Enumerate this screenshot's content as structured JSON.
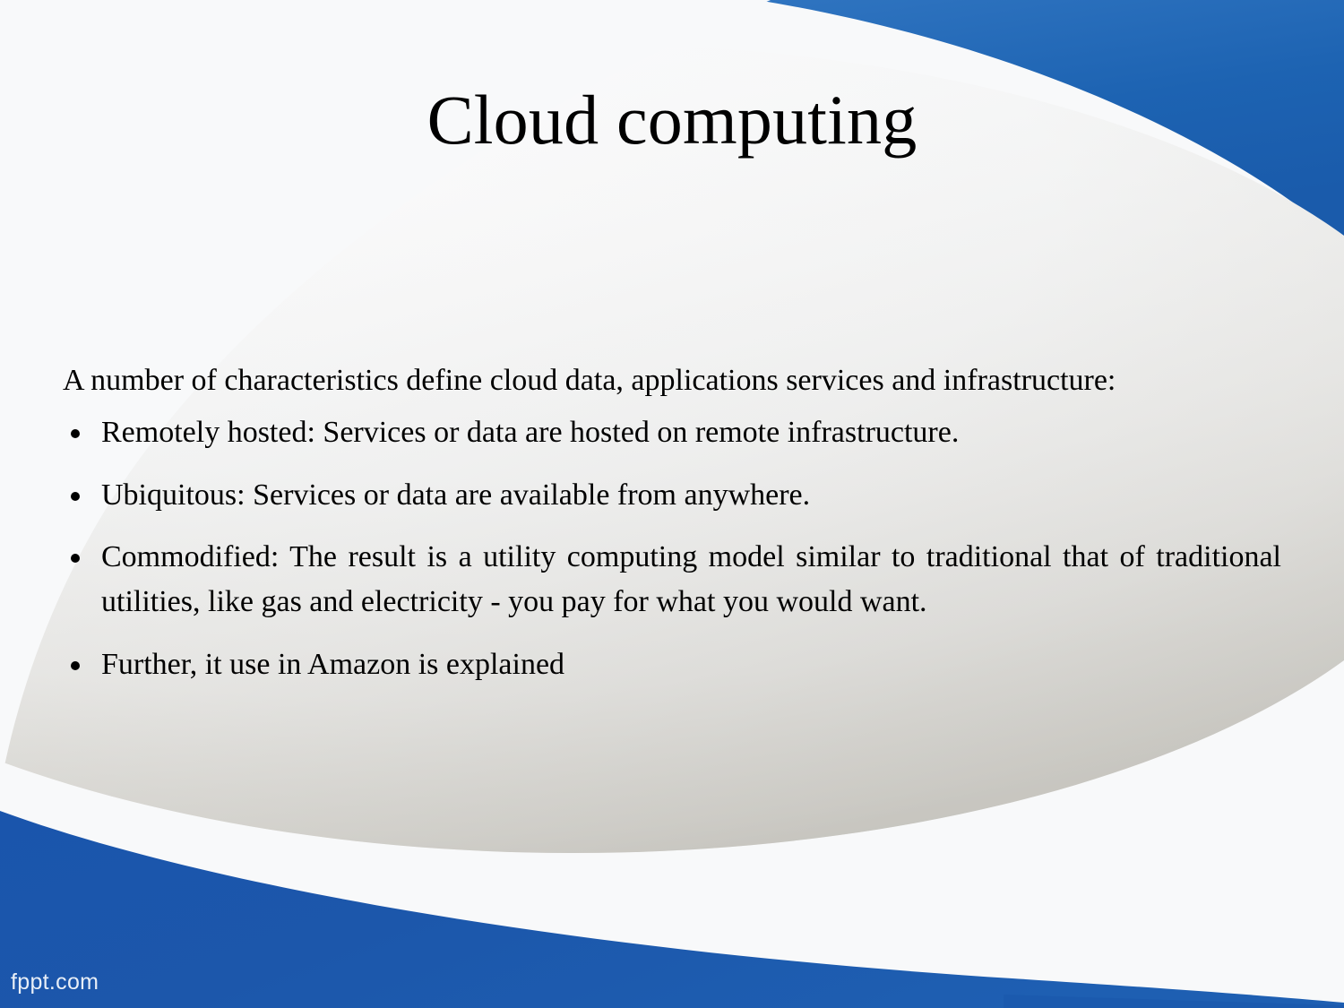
{
  "slide": {
    "title": "Cloud computing",
    "intro": "A number of characteristics define cloud data, applications services and infrastructure:",
    "bullets": [
      "Remotely hosted: Services or data are hosted on remote infrastructure.",
      "Ubiquitous: Services or data are available from anywhere.",
      "Commodified: The result is a utility computing model similar to traditional that of traditional utilities, like gas and electricity - you pay for what you would want.",
      "Further, it use in Amazon is explained"
    ],
    "watermark": "fppt.com"
  },
  "theme": {
    "blue_top": "#1b60b0",
    "blue_bottom": "#1850a8",
    "page_background": "#f8f9fa",
    "text_color": "#000000",
    "watermark_color": "#e8eef7"
  }
}
